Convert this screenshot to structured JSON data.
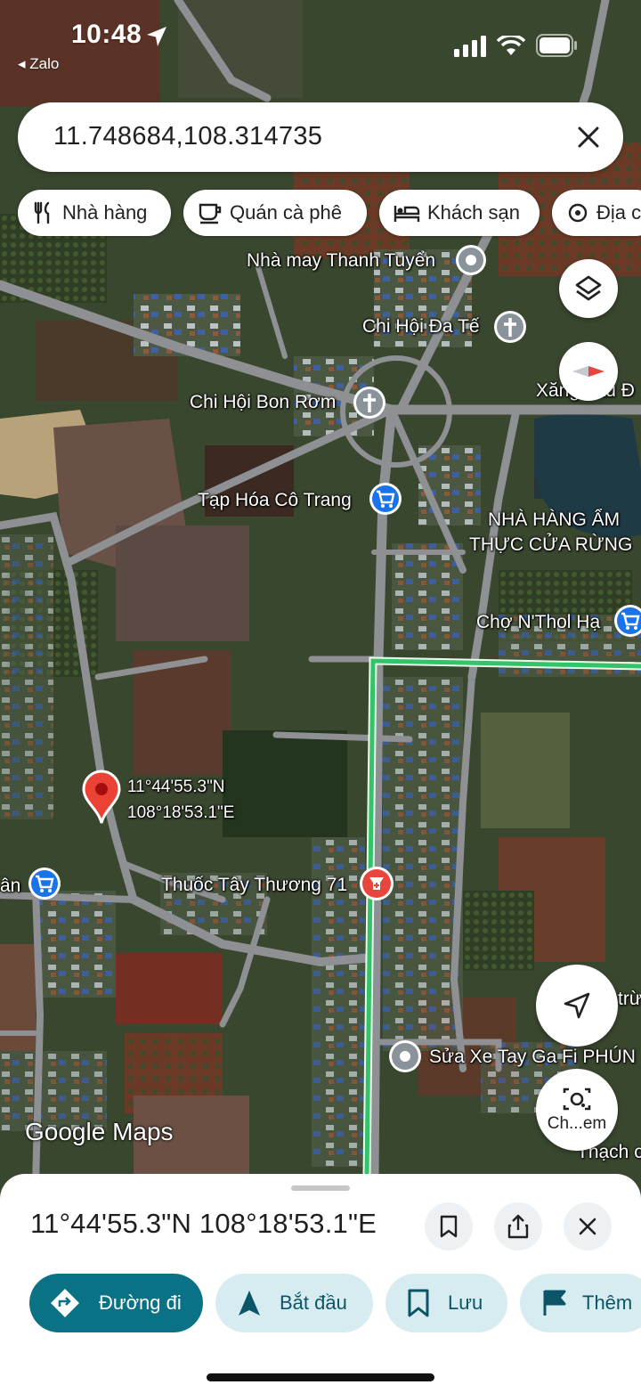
{
  "status_bar": {
    "time": "10:48",
    "back_app": "◂ Zalo",
    "icons": [
      "location-arrow-icon",
      "cellular-signal-icon",
      "wifi-icon",
      "battery-icon"
    ]
  },
  "search": {
    "query": "11.748684,108.314735",
    "clear_icon": "close-icon"
  },
  "chips": [
    {
      "label": "Nhà hàng",
      "icon": "restaurant-icon"
    },
    {
      "label": "Quán cà phê",
      "icon": "coffee-icon"
    },
    {
      "label": "Khách sạn",
      "icon": "hotel-icon"
    },
    {
      "label": "Địa c",
      "icon": "attraction-icon"
    }
  ],
  "places": {
    "nha_may": "Nhà may Thanh Tuyển",
    "chi_hoi_da_te": "Chi Hội Đa Tế",
    "xang_dau": "Xăng dầu Đ",
    "chi_hoi_bon_rom": "Chi Hội Bon Rơm",
    "tap_hoa": "Tạp Hóa Cô Trang",
    "nha_hang_line1": "NHÀ HÀNG ẨM",
    "nha_hang_line2": "THỰC CỬA RỪNG",
    "cho": "Chợ N'Thol Hạ",
    "pin_lat": "11°44'55.3\"N",
    "pin_lng": "108°18'53.1\"E",
    "left_store": "ân",
    "pharmacy": "Thuốc Tây Thương 71",
    "sua_xe": "Sửa Xe Tay Ga Fi PHÚN",
    "trung": "trừn",
    "thach": "Thạch c"
  },
  "map_controls": {
    "layers_icon": "layers-icon",
    "compass_icon": "compass-icon",
    "my_location_icon": "navigation-arrow-icon",
    "lens_label": "Ch...em",
    "lens_icon": "camera-search-icon"
  },
  "branding": {
    "logo": "Google Maps"
  },
  "colors": {
    "accent": "#0b7285",
    "route": "#34c26a",
    "pin": "#ea4335",
    "shopping": "#1a73e8",
    "pharmacy": "#e8453c",
    "place_gray": "#70757a"
  },
  "bottom_sheet": {
    "title": "11°44'55.3\"N 108°18'53.1\"E",
    "buttons": [
      {
        "label": "Đường đi",
        "icon": "directions-icon",
        "primary": true
      },
      {
        "label": "Bắt đầu",
        "icon": "navigation-icon",
        "primary": false
      },
      {
        "label": "Lưu",
        "icon": "bookmark-icon",
        "primary": false
      },
      {
        "label": "Thêm",
        "icon": "flag-icon",
        "primary": false
      }
    ],
    "icon_buttons": [
      "bookmark-icon",
      "share-icon",
      "close-icon"
    ]
  }
}
